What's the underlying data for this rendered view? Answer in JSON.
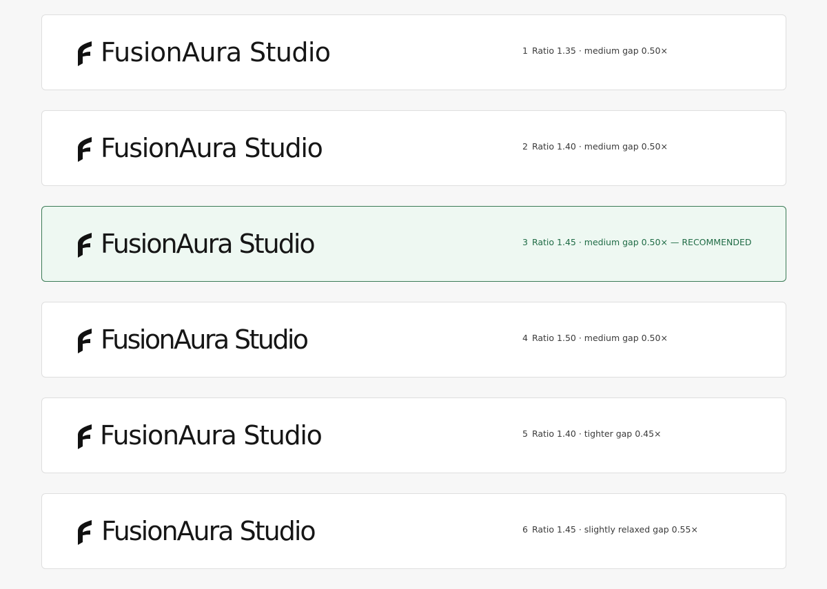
{
  "brand": {
    "wordmark": "FusionAura Studio",
    "mark_icon": "stylized-f-logo-icon",
    "mark_color": "#111111"
  },
  "accent": {
    "recommended_border": "#3a7a55",
    "recommended_background": "#eef8f2",
    "recommended_text": "#1f6b45"
  },
  "variants": [
    {
      "number": "1",
      "caption": "Ratio 1.35 · medium gap 0.50×",
      "recommended": false
    },
    {
      "number": "2",
      "caption": "Ratio 1.40 · medium gap 0.50×",
      "recommended": false
    },
    {
      "number": "3",
      "caption": "Ratio 1.45 · medium gap 0.50× — RECOMMENDED",
      "recommended": true
    },
    {
      "number": "4",
      "caption": "Ratio 1.50 · medium gap 0.50×",
      "recommended": false
    },
    {
      "number": "5",
      "caption": "Ratio 1.40 · tighter gap 0.45×",
      "recommended": false
    },
    {
      "number": "6",
      "caption": "Ratio 1.45 · slightly relaxed gap 0.55×",
      "recommended": false
    }
  ]
}
